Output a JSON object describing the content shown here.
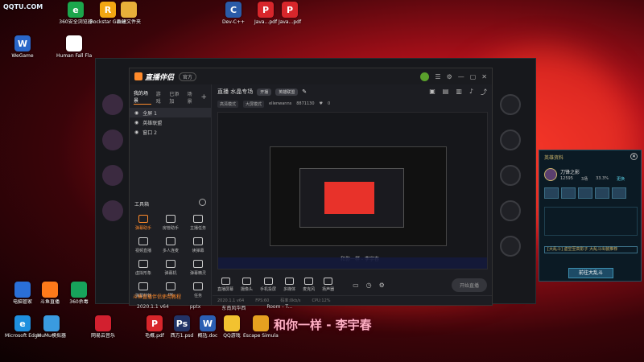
{
  "desktop": {
    "watermark": "QQTU.COM",
    "icons": [
      {
        "label": "360安全浏览器",
        "color": "#1ca64c",
        "glyph": "e"
      },
      {
        "label": "Rockstar Games...",
        "color": "#f3a712",
        "glyph": "R"
      },
      {
        "label": "新建文件夹",
        "color": "#e8b03a",
        "glyph": ""
      },
      {
        "label": "Dev-C++",
        "color": "#2a5ba8",
        "glyph": "C"
      },
      {
        "label": "Java...pdf",
        "color": "#d8262b",
        "glyph": "P"
      },
      {
        "label": "Java...pdf",
        "color": "#d8262b",
        "glyph": "P"
      },
      {
        "label": "WeGame",
        "color": "#2a67c9",
        "glyph": "W"
      },
      {
        "label": "Human Fall Flat",
        "color": "#ffffff",
        "glyph": ""
      },
      {
        "label": "Microsoft Edge",
        "color": "#1f8fde",
        "glyph": "e"
      },
      {
        "label": "MuMu模拟器",
        "color": "#3a9be0",
        "glyph": ""
      },
      {
        "label": "网易云音乐",
        "color": "#d2202f",
        "glyph": ""
      },
      {
        "label": "毛概.pdf",
        "color": "#d8262b",
        "glyph": "P"
      },
      {
        "label": "西方1.psd",
        "color": "#223366",
        "glyph": "Ps"
      },
      {
        "label": "概括.doc",
        "color": "#2b5fb3",
        "glyph": "W"
      },
      {
        "label": "QQ游戏",
        "color": "#f2c230",
        "glyph": ""
      },
      {
        "label": "Escape Simulator",
        "color": "#e6a020",
        "glyph": ""
      },
      {
        "label": "电脑管家",
        "color": "#2a6fd8",
        "glyph": ""
      },
      {
        "label": "斗鱼直播",
        "color": "#ff7a1a",
        "glyph": ""
      },
      {
        "label": "360杀毒",
        "color": "#17a35b",
        "glyph": ""
      }
    ],
    "lyric": "和你一样 - 李宇春"
  },
  "app": {
    "title": "直播伴侣",
    "version": "官方",
    "tabs": [
      "我的场景",
      "游戏",
      "已添加",
      "场景"
    ],
    "scenes": [
      "全屏 1",
      "英雄联盟",
      "窗口 2"
    ],
    "tools_title": "工具箱",
    "tools": [
      {
        "label": "弹幕助手"
      },
      {
        "label": "房管助手"
      },
      {
        "label": "主播任务"
      },
      {
        "label": "视频直播"
      },
      {
        "label": "多人连麦"
      },
      {
        "label": "读弹幕"
      },
      {
        "label": "虚拟形象"
      },
      {
        "label": "弹幕机"
      },
      {
        "label": "弹幕精灵"
      },
      {
        "label": "弹幕特效"
      },
      {
        "label": "PK"
      },
      {
        "label": "任务"
      }
    ],
    "left_footer": "斗鱼直播伴侣使用教程",
    "room_title": "直播 水晶专场",
    "room_badge": "开播",
    "room_category": "英雄联盟",
    "sub_bar": {
      "btn1": "高清模式",
      "btn2": "大屏模式",
      "streamer": "ellenwanns",
      "id": "8871130",
      "viewers": "0"
    },
    "preview_caption": "和你一样 - 李宇春",
    "controls": [
      "直播屏幕",
      "摄像头",
      "手机投屏",
      "多媒体",
      "麦克风",
      "扬声器"
    ],
    "live_button": "开始直播",
    "status": [
      "2020.1.1 v64",
      "FPS:60",
      "码率:0kb/s",
      "CPU:12%"
    ]
  },
  "hero_panel": {
    "title": "英雄资料",
    "name": "刀锋之影",
    "stat1": "12595",
    "stat2": "3场",
    "stat3": "33.3%",
    "link": "更换",
    "field": "[大乱斗] 虚空至高影子 大乱斗出装推荐",
    "button": "前往大乱斗"
  },
  "taskbar_strip": [
    "2020.1.1 v64",
    "pptx",
    "东南风华西",
    "Room - T..."
  ]
}
